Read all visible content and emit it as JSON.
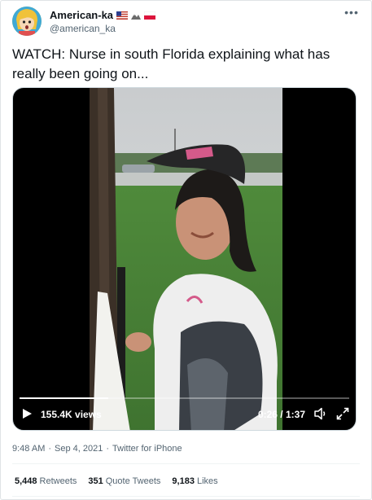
{
  "user": {
    "display_name": "American-ka",
    "handle": "@american_ka",
    "flags": [
      "us-flag-icon",
      "mountain-icon",
      "poland-flag-icon"
    ]
  },
  "tweet": {
    "text_line1": "WATCH: Nurse in south Florida explaining what  has",
    "text_line2": "really been going on..."
  },
  "video": {
    "views": "155.4K views",
    "time": "0:26 / 1:37",
    "progress": 0.268
  },
  "meta": {
    "time": "9:48 AM",
    "date": "Sep 4, 2021",
    "source": "Twitter for iPhone",
    "sep": "·"
  },
  "stats": {
    "retweets_count": "5,448",
    "retweets_label": "Retweets",
    "quotes_count": "351",
    "quotes_label": "Quote Tweets",
    "likes_count": "9,183",
    "likes_label": "Likes"
  },
  "colors": {
    "text": "#0f1419",
    "secondary": "#536471",
    "border": "#cfd9de"
  }
}
